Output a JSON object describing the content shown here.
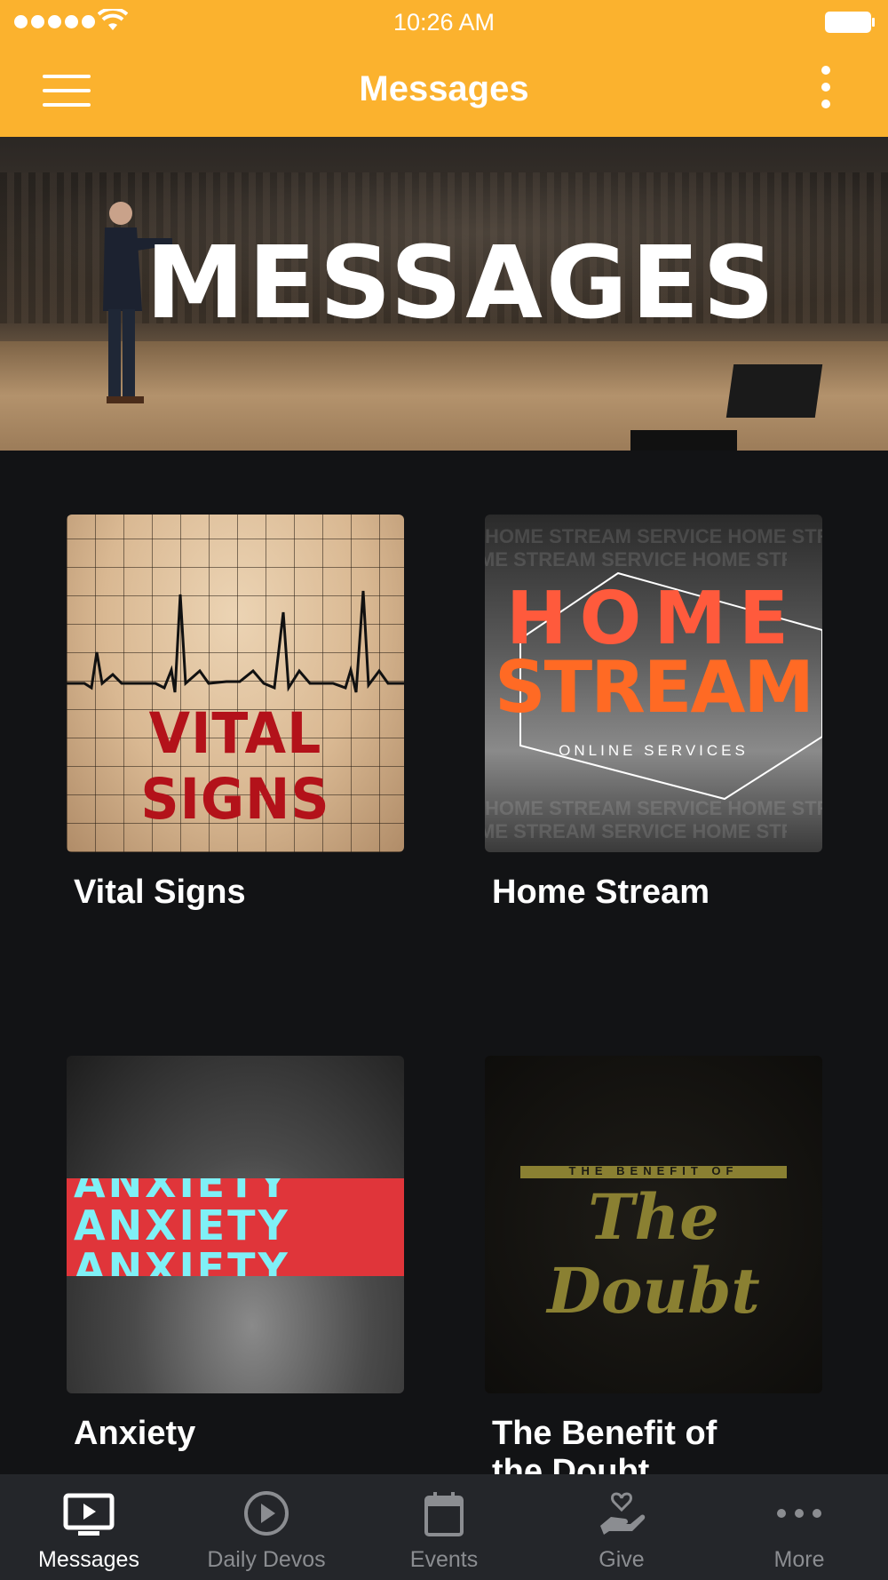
{
  "status_bar": {
    "time": "10:26 AM"
  },
  "header": {
    "title": "Messages"
  },
  "hero": {
    "title": "MESSAGES"
  },
  "series": [
    {
      "title": "Vital Signs",
      "art_text": "VITAL SIGNS"
    },
    {
      "title": "Home Stream",
      "art_line1": "HOME",
      "art_line2": "STREAM",
      "art_subtitle": "ONLINE SERVICES",
      "art_bg_text": "HOME STREAM SERVICE  HOME STREAM SERVICE  HOME STREAM SERVICE"
    },
    {
      "title": "Anxiety",
      "art_text": "ANXIETY"
    },
    {
      "title": "The Benefit of the Doubt",
      "art_top": "THE BENEFIT OF",
      "art_main": "The Doubt"
    }
  ],
  "tabs": [
    {
      "label": "Messages",
      "icon": "tv-play-icon",
      "active": true
    },
    {
      "label": "Daily Devos",
      "icon": "play-circle-icon",
      "active": false
    },
    {
      "label": "Events",
      "icon": "calendar-icon",
      "active": false
    },
    {
      "label": "Give",
      "icon": "hand-heart-icon",
      "active": false
    },
    {
      "label": "More",
      "icon": "more-dots-icon",
      "active": false
    }
  ],
  "colors": {
    "accent": "#fbb22e",
    "background": "#121315",
    "tabbar": "#24262a",
    "tab_inactive": "#8b8d91"
  }
}
